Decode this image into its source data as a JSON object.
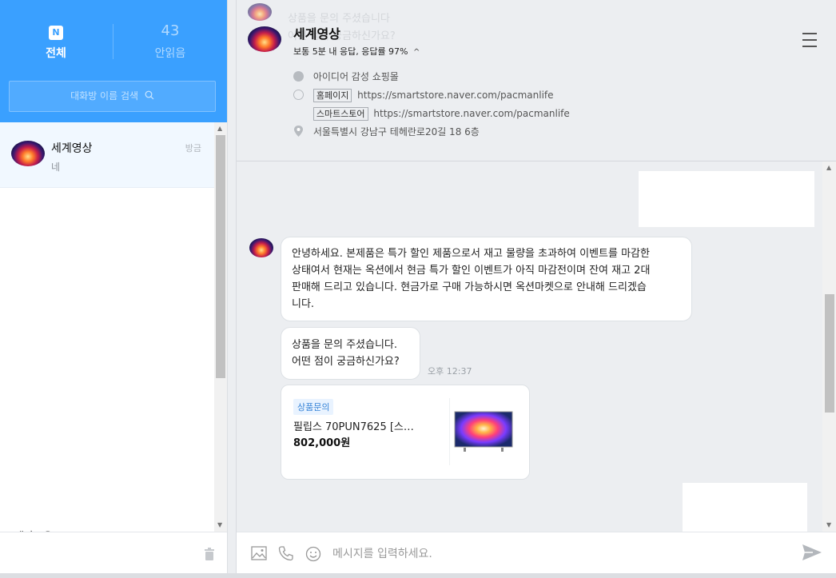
{
  "left_panel": {
    "tabs": [
      {
        "icon": "n-chat-icon",
        "count": "",
        "label": "전체"
      },
      {
        "icon": "",
        "count": "43",
        "label": "안읽음"
      }
    ],
    "search_placeholder": "대화방 이름 검색",
    "chat_items": [
      {
        "name": "세계영상",
        "time": "방금",
        "last_message": "네"
      }
    ],
    "partial_item_name": "패카드유"
  },
  "store": {
    "name": "세계영상",
    "response": "보통 5분 내 응답, 응답률 97%",
    "category": "아이디어 감성 쇼핑몰",
    "homepage_tag": "홈페이지",
    "homepage_url": "https://smartstore.naver.com/pacmanlife",
    "smartstore_tag": "스마트스토어",
    "smartstore_url": "https://smartstore.naver.com/pacmanlife",
    "address": "서울특별시 강남구 테헤란로20길 18 6층"
  },
  "ghost_text": [
    "상품을 문의 주셨습니다",
    "어떤 점이 궁금하신가요?"
  ],
  "messages": {
    "message_1": [
      "안녕하세요. 본제품은 특가 할인 제품으로서 재고 물량을 초과하여 이벤트를 마감한",
      "상태여서 현재는 옥션에서 현금 특가 할인 이벤트가 아직 마감전이며 잔여 재고 2대",
      "판매해 드리고 있습니다. 현금가로 구매 가능하시면 옥션마켓으로 안내해 드리겠습",
      "니다."
    ],
    "message_2": [
      "상품을 문의 주셨습니다.",
      "어떤 점이 궁금하신가요?"
    ],
    "time": "오후 12:37",
    "product": {
      "badge": "상품문의",
      "name": "필립스 70PUN7625 [스…",
      "price": "802,000원"
    }
  },
  "input": {
    "placeholder": "메시지를 입력하세요."
  },
  "colors": {
    "brand_blue": "#3aa0ff",
    "selected_chat_bg": "#f1f8ff",
    "badge_bg": "#e9f3ff"
  }
}
